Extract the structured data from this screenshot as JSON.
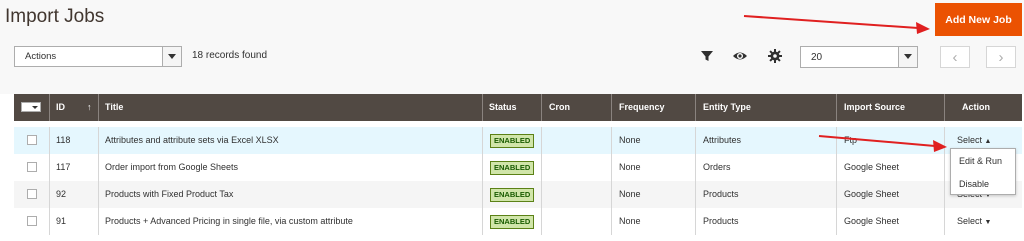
{
  "header": {
    "title": "Import Jobs",
    "add_button": "Add New Job"
  },
  "toolbar": {
    "actions_label": "Actions",
    "records_found": "18 records found",
    "page_size": "20",
    "prev_label": "‹",
    "next_label": "›"
  },
  "table": {
    "columns": {
      "id": "ID",
      "title": "Title",
      "status": "Status",
      "cron": "Cron",
      "frequency": "Frequency",
      "entity_type": "Entity Type",
      "import_source": "Import Source",
      "action": "Action"
    },
    "rows": [
      {
        "id": "118",
        "title": "Attributes and attribute sets via Excel XLSX",
        "status": "ENABLED",
        "cron": "",
        "frequency": "None",
        "entity_type": "Attributes",
        "import_source": "Ftp",
        "action": "Select"
      },
      {
        "id": "117",
        "title": "Order import from Google Sheets",
        "status": "ENABLED",
        "cron": "",
        "frequency": "None",
        "entity_type": "Orders",
        "import_source": "Google Sheet",
        "action": ""
      },
      {
        "id": "92",
        "title": "Products with Fixed Product Tax",
        "status": "ENABLED",
        "cron": "",
        "frequency": "None",
        "entity_type": "Products",
        "import_source": "Google Sheet",
        "action": "Select"
      },
      {
        "id": "91",
        "title": "Products + Advanced Pricing in single file, via custom attribute",
        "status": "ENABLED",
        "cron": "",
        "frequency": "None",
        "entity_type": "Products",
        "import_source": "Google Sheet",
        "action": "Select"
      }
    ]
  },
  "action_dropdown": {
    "items": [
      "Edit & Run",
      "Disable"
    ]
  },
  "colors": {
    "accent": "#eb5202",
    "header_bg": "#514943",
    "annotation_arrow": "#e02020",
    "link": "#007bdb"
  }
}
